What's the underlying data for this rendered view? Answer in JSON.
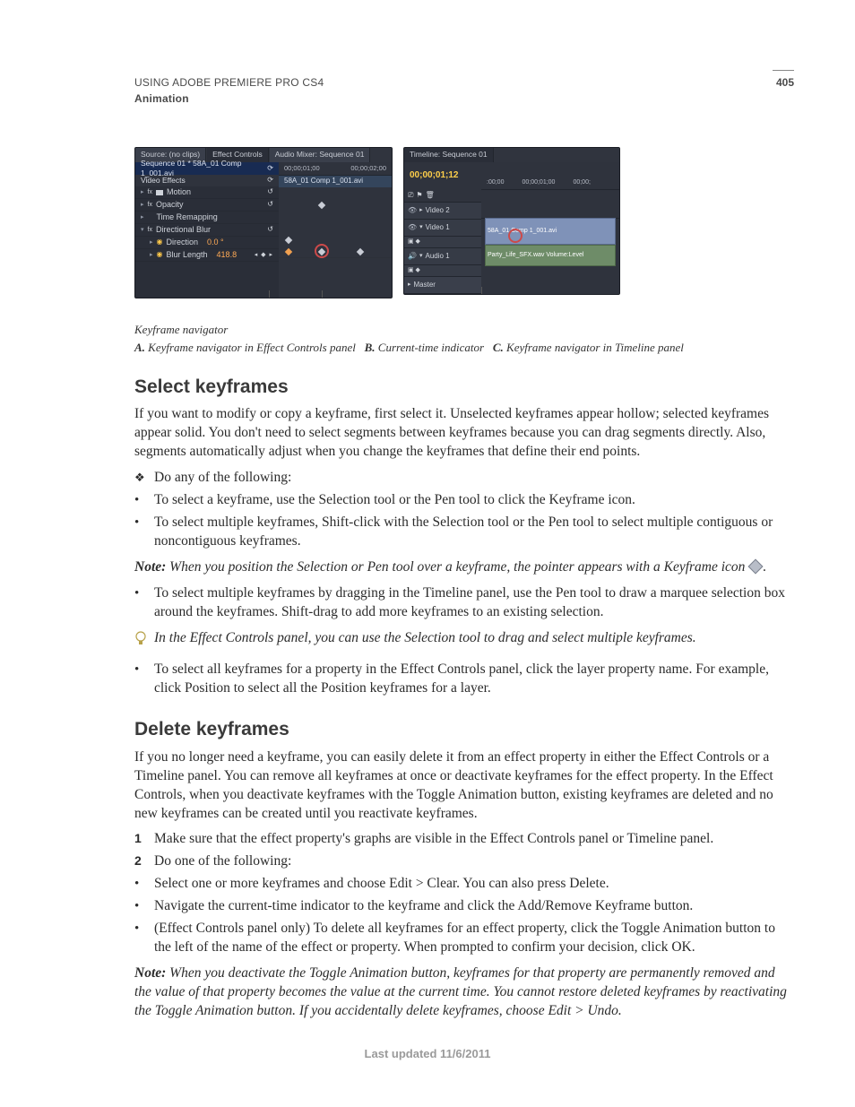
{
  "header": {
    "line1": "USING ADOBE PREMIERE PRO CS4",
    "line2": "Animation",
    "page_number": "405"
  },
  "figure": {
    "ec": {
      "tabs": [
        "Source: (no clips)",
        "Effect Controls",
        "Audio Mixer: Sequence 01"
      ],
      "seq_header": "Sequence 01 * 58A_01 Comp 1_001.avi",
      "section": "Video Effects",
      "time_a": "00;00;01;00",
      "time_b": "00;00;02;00",
      "clip_header": "58A_01 Comp 1_001.avi",
      "rows": {
        "motion": "Motion",
        "opacity": "Opacity",
        "time_remap": "Time Remapping",
        "dir_blur": "Directional Blur",
        "direction": "Direction",
        "direction_val": "0.0 °",
        "blur_len": "Blur Length",
        "blur_len_val": "418.8"
      }
    },
    "tl": {
      "tab": "Timeline: Sequence 01",
      "timecode": "00;00;01;12",
      "ruler": [
        ":00;00",
        "00;00;01;00",
        "00;00;"
      ],
      "tracks": {
        "v2": "Video 2",
        "v1": "Video 1",
        "a1": "Audio 1",
        "master": "Master"
      },
      "clip_v1": "58A_01 Comp 1_001.avi",
      "clip_a1": "Party_Life_SFX.wav Volume:Level"
    },
    "labels": {
      "A": "A",
      "B": "B",
      "C": "C"
    },
    "caption": "Keyframe navigator",
    "legend": {
      "A": "Keyframe navigator in Effect Controls panel",
      "B": "Current-time indicator",
      "C": "Keyframe navigator in Timeline panel"
    }
  },
  "s1": {
    "heading": "Select keyframes",
    "p1": "If you want to modify or copy a keyframe, first select it. Unselected keyframes appear hollow; selected keyframes appear solid. You don't need to select segments between keyframes because you can drag segments directly. Also, segments automatically adjust when you change the keyframes that define their end points.",
    "b1": "Do any of the following:",
    "b2": "To select a keyframe, use the Selection tool or the Pen tool to click the Keyframe icon.",
    "b3": "To select multiple keyframes, Shift-click with the Selection tool or the Pen tool to select multiple contiguous or noncontiguous keyframes.",
    "note_label": "Note:",
    "note1": "When you position the Selection or Pen tool over a keyframe, the pointer appears with a Keyframe icon",
    "note1_tail": ".",
    "b4": "To select multiple keyframes by dragging in the Timeline panel, use the Pen tool to draw a marquee selection box around the keyframes. Shift-drag to add more keyframes to an existing selection.",
    "tip": "In the Effect Controls panel, you can use the Selection tool to drag and select multiple keyframes.",
    "b5": "To select all keyframes for a property in the Effect Controls panel, click the layer property name. For example, click Position to select all the Position keyframes for a layer."
  },
  "s2": {
    "heading": "Delete keyframes",
    "p1": "If you no longer need a keyframe, you can easily delete it from an effect property in either the Effect Controls or a Timeline panel. You can remove all keyframes at once or deactivate keyframes for the effect property. In the Effect Controls, when you deactivate keyframes with the Toggle Animation button, existing keyframes are deleted and no new keyframes can be created until you reactivate keyframes.",
    "n1": "Make sure that the effect property's graphs are visible in the Effect Controls panel or Timeline panel.",
    "n2": "Do one of the following:",
    "b1": "Select one or more keyframes and choose Edit > Clear. You can also press Delete.",
    "b2": "Navigate the current-time indicator to the keyframe and click the Add/Remove Keyframe button.",
    "b3": "(Effect Controls panel only) To delete all keyframes for an effect property, click the Toggle Animation button to the left of the name of the effect or property. When prompted to confirm your decision, click OK.",
    "note_label": "Note:",
    "note": "When you deactivate the Toggle Animation button, keyframes for that property are permanently removed and the value of that property becomes the value at the current time. You cannot restore deleted keyframes by reactivating the Toggle Animation button. If you accidentally delete keyframes, choose Edit > Undo."
  },
  "footer": "Last updated 11/6/2011"
}
